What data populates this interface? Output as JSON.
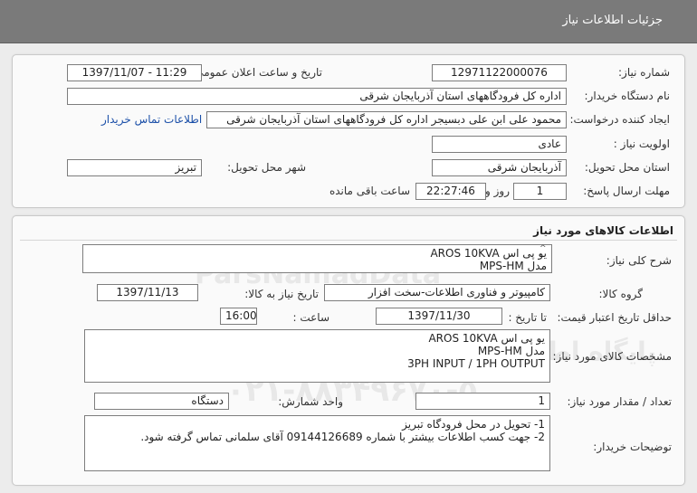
{
  "page": {
    "title": "جزئیات اطلاعات نیاز"
  },
  "header_panel": {
    "need_number_label": "شماره نیاز:",
    "need_number": "12971122000076",
    "announce_label": "تاریخ و ساعت اعلان عمومی:",
    "announce_value": "1397/11/07 - 11:29",
    "buyer_org_label": "نام دستگاه خریدار:",
    "buyer_org": "اداره کل فرودگاههای استان آذربایجان شرقی",
    "requester_label": "ایجاد کننده درخواست:",
    "requester": "محمود علی ابن علی دبسیجر اداره کل فرودگاههای استان آذربایجان شرقی",
    "contact_link": "اطلاعات تماس خریدار",
    "priority_label": "اولویت نیاز :",
    "priority": "عادی",
    "province_label": "استان محل تحویل:",
    "province": "آذربایجان شرقی",
    "city_label": "شهر محل تحویل:",
    "city": "تبریز",
    "deadline_label": "مهلت ارسال پاسخ:",
    "deadline_days": "1",
    "days_word": "روز و",
    "deadline_time": "22:27:46",
    "remaining_label": "ساعت باقی مانده"
  },
  "goods_panel": {
    "section_title": "اطلاعات کالاهای مورد نیاز",
    "general_desc_label": "شرح کلی نیاز:",
    "general_desc_lines": [
      "یو پی اس AROS 10KVA",
      "مدل MPS-HM"
    ],
    "group_label": "گروه کالا:",
    "group_value": "کامپیوتر و فناوری اطلاعات-سخت افزار",
    "need_date_label": "تاریخ نیاز به کالا:",
    "need_date": "1397/11/13",
    "validity_label": "حداقل تاریخ اعتبار قیمت:",
    "until_date_label": "تا تاریخ :",
    "until_date": "1397/11/30",
    "hour_label": "ساعت :",
    "hour_value": "16:00",
    "specs_label": "مشخصات کالای مورد نیاز:",
    "specs_lines": [
      "یو پی اس AROS 10KVA",
      "مدل MPS-HM",
      "3PH INPUT / 1PH OUTPUT"
    ],
    "qty_label": "تعداد / مقدار مورد نیاز:",
    "qty_value": "1",
    "unit_label": "واحد شمارش:",
    "unit_value": "دستگاه",
    "buyer_notes_label": "توضیحات خریدار:",
    "buyer_notes_lines": [
      "1- تحویل در محل فرودگاه تبریز",
      "2- جهت کسب اطلاعات بیشتر با شماره 09144126689 آقای سلمانی تماس گرفته شود."
    ]
  },
  "watermark": {
    "brand": "ParsNamadData",
    "tagline": "پایگاه اطلاع رسانی مناقصه و مزایده",
    "phone": "۰۲۱-۸۸۳۴۹۶۷۰-۵"
  }
}
